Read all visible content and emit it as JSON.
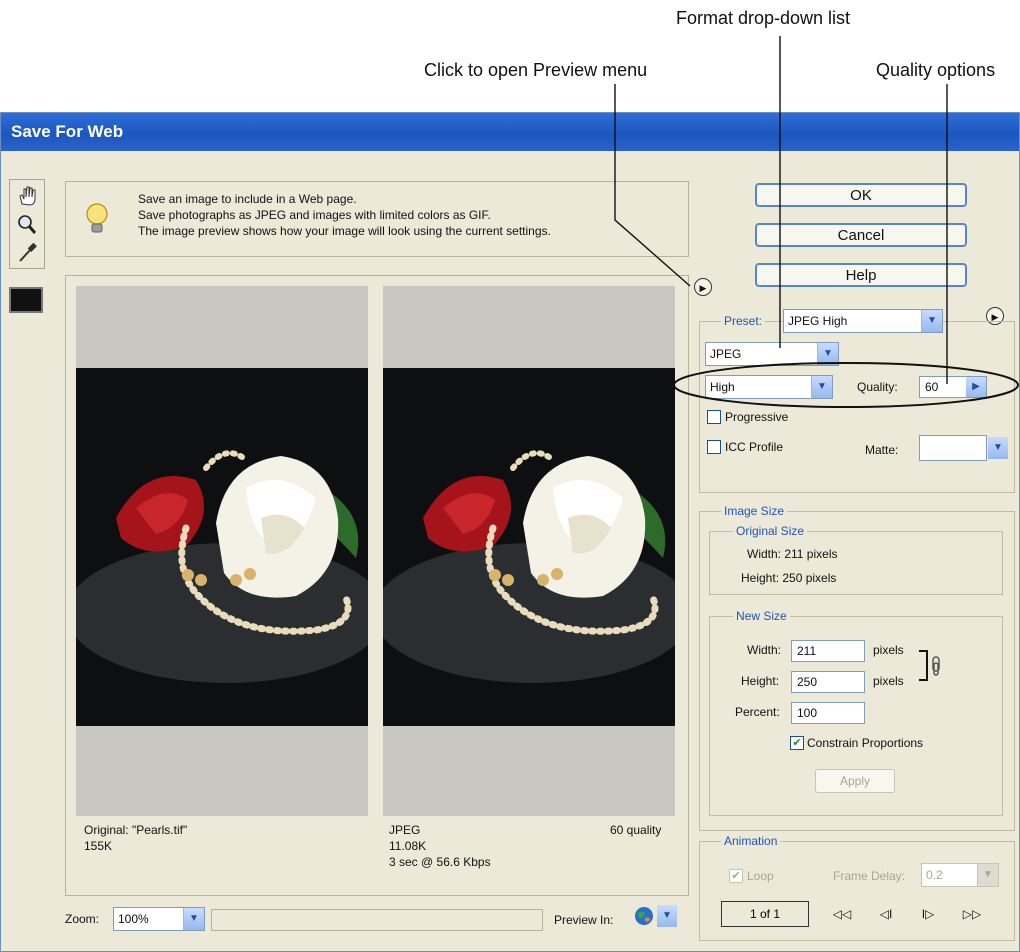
{
  "callouts": {
    "format": "Format drop-down list",
    "preview": "Click to open Preview menu",
    "quality": "Quality options"
  },
  "window": {
    "title": "Save For Web"
  },
  "tip": {
    "line1": "Save an image to include in a Web page.",
    "line2": "Save photographs as JPEG and images with limited colors as GIF.",
    "line3": "The image preview shows how your image will look using the current settings."
  },
  "preview": {
    "original": {
      "name": "Original: \"Pearls.tif\"",
      "size": "155K"
    },
    "optimized": {
      "format": "JPEG",
      "quality": "60 quality",
      "size": "11.08K",
      "speed": "3 sec @ 56.6 Kbps"
    }
  },
  "buttons": {
    "ok": "OK",
    "cancel": "Cancel",
    "help": "Help"
  },
  "settings": {
    "preset_label": "Preset:",
    "preset_value": "JPEG High",
    "format_value": "JPEG",
    "compression_value": "High",
    "quality_label": "Quality:",
    "quality_value": "60",
    "progressive_label": "Progressive",
    "icc_label": "ICC Profile",
    "matte_label": "Matte:",
    "matte_value": ""
  },
  "image_size": {
    "title": "Image Size",
    "original_title": "Original Size",
    "orig_width": "Width:  211 pixels",
    "orig_height": "Height:  250 pixels",
    "new_title": "New Size",
    "width_label": "Width:",
    "width_value": "211",
    "height_label": "Height:",
    "height_value": "250",
    "percent_label": "Percent:",
    "percent_value": "100",
    "unit1": "pixels",
    "unit2": "pixels",
    "constrain_label": "Constrain Proportions",
    "apply_label": "Apply"
  },
  "animation": {
    "title": "Animation",
    "loop_label": "Loop",
    "frame_delay_label": "Frame Delay:",
    "frame_delay_value": "0.2",
    "frame_counter": "1 of 1",
    "first": "◁◁",
    "prev": "◁I",
    "next": "I▷",
    "last": "▷▷"
  },
  "bottom": {
    "zoom_label": "Zoom:",
    "zoom_value": "100%",
    "preview_in_label": "Preview In:"
  },
  "colors": {
    "accent": "#1f56b6",
    "title_bar": "#1d56c0",
    "dialog_bg": "#ece9d8"
  }
}
